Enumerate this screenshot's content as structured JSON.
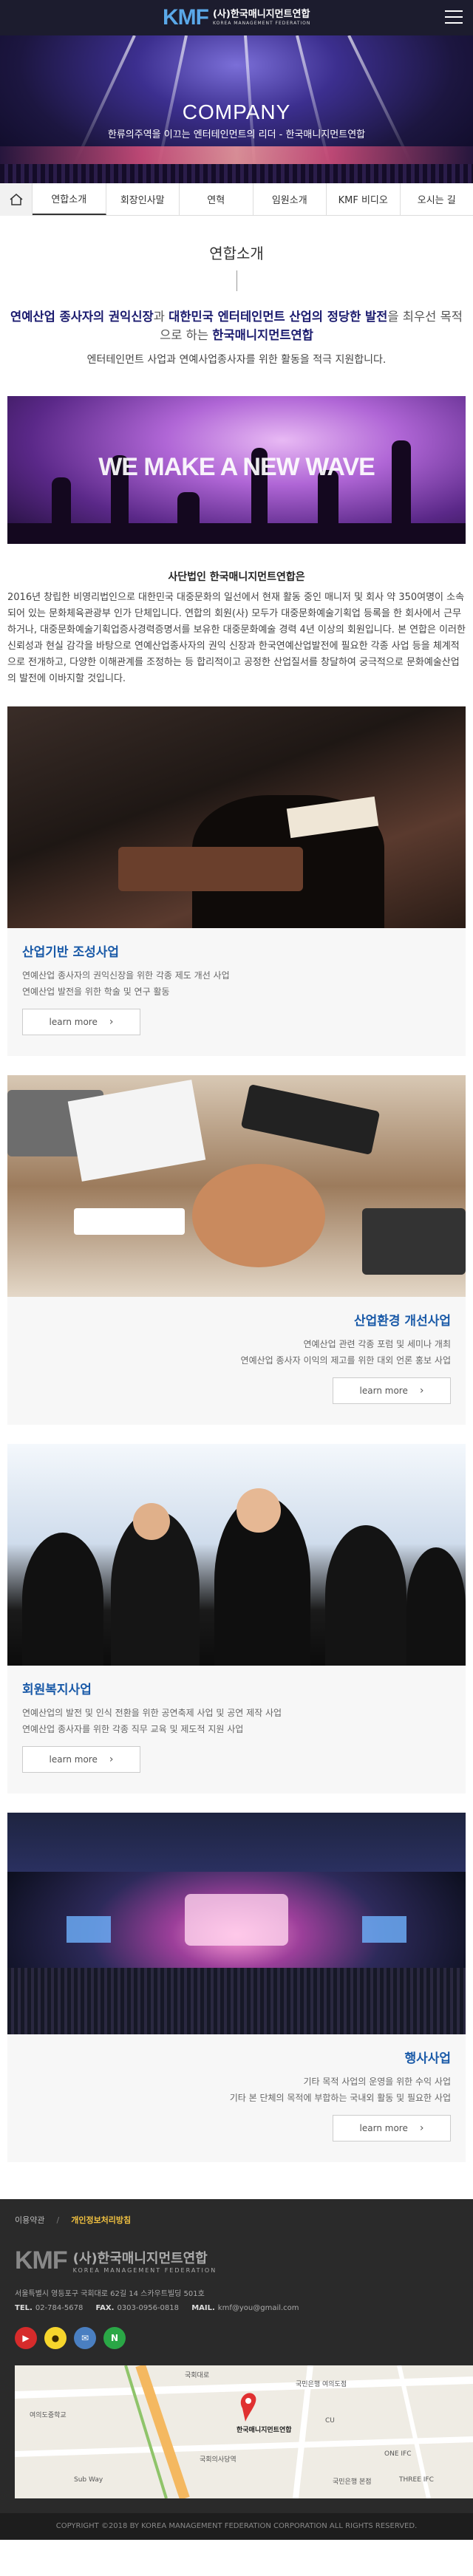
{
  "header": {
    "logo_mark": "KMF",
    "logo_name": "(사)한국매니지먼트연합",
    "logo_en": "KOREA MANAGEMENT FEDERATION"
  },
  "hero": {
    "title": "COMPANY",
    "subtitle": "한류의주역을 이끄는 엔터테인먼트의 리더 - 한국매니지먼트연합"
  },
  "tabs": [
    {
      "label": "연합소개",
      "active": true
    },
    {
      "label": "회장인사말",
      "active": false
    },
    {
      "label": "연혁",
      "active": false
    },
    {
      "label": "임원소개",
      "active": false
    },
    {
      "label": "KMF 비디오",
      "active": false
    },
    {
      "label": "오시는 길",
      "active": false
    }
  ],
  "intro": {
    "title": "연합소개",
    "lead_part1": "연예산업 종사자의 권익신장",
    "lead_plain1": "과 ",
    "lead_part2": "대한민국 엔터테인먼트 산업의 정당한 발전",
    "lead_plain2": "을 최우선 목적으로 하는 ",
    "lead_part3": "한국매니지먼트연합",
    "subline": "엔터테인먼트 사업과 연예사업종사자를 위한 활동을 적극 지원합니다.",
    "banner_text": "WE MAKE A NEW WAVE",
    "org_heading": "사단법인 한국매니지먼트연합은",
    "org_text": "2016년 창립한 비영리법인으로 대한민국 대중문화의 일선에서 현재 활동 중인 매니저 및 회사 약 350여명이 소속되어 있는 문화체육관광부 인가 단체입니다. 연합의 회원(사) 모두가 대중문화예술기획업 등록을 한 회사에서 근무하거나, 대중문화예술기획업증사경력증명서를 보유한 대중문화예술 경력 4년 이상의 회원입니다. 본 연합은 이러한 신뢰성과 현실 감각을 바탕으로 연예산업종사자의 권익 신장과 한국연예산업발전에 필요한 각종 사업 등을 체계적으로 전개하고, 다양한 이해관계를 조정하는 등 합리적이고 공정한 산업질서를 창달하여 궁극적으로 문화예술산업의 발전에 이바지할 것입니다."
  },
  "cards": [
    {
      "title": "산업기반 조성사업",
      "lines": [
        "연예산업 종사자의 권익신장을 위한 각종 제도 개선 사업",
        "연예산업 발전을 위한 학술 및 연구 활동"
      ],
      "button": "learn more",
      "align": "left"
    },
    {
      "title": "산업환경 개선사업",
      "lines": [
        "연예산업 관련 각종 포럼 및 세미나 개최",
        "연예산업 종사자 이익의 제고를 위한 대외 언론 홍보 사업"
      ],
      "button": "learn more",
      "align": "right"
    },
    {
      "title": "회원복지사업",
      "lines": [
        "연예산업의 발전 및 인식 전환을 위한 공연축제 사업 및 공연 제작 사업",
        "연예산업 종사자를 위한 각종 직무 교육 및 제도적 지원 사업"
      ],
      "button": "learn more",
      "align": "left"
    },
    {
      "title": "행사사업",
      "lines": [
        "기타 목적 사업의 운영을 위한 수익 사업",
        "기타 본 단체의 목적에 부합하는 국내외 활동 및 필요한 사업"
      ],
      "button": "learn more",
      "align": "right"
    }
  ],
  "footer": {
    "link1": "이용약관",
    "link2": "개인정보처리방침",
    "logo_mark": "KMF",
    "logo_name": "(사)한국매니지먼트연합",
    "logo_en": "KOREA MANAGEMENT FEDERATION",
    "address": "서울특별시 영등포구 국회대로 62길 14 스카우트빌딩 501호",
    "tel_label": "TEL.",
    "tel": "02-784-5678",
    "fax_label": "FAX.",
    "fax": "0303-0956-0818",
    "mail_label": "MAIL.",
    "mail": "kmf@you@gmail.com",
    "sns": [
      {
        "name": "youtube-icon",
        "glyph": "▶",
        "color": "#d62b2b"
      },
      {
        "name": "kakao-icon",
        "glyph": "●",
        "color": "#f6d52c"
      },
      {
        "name": "mail-icon",
        "glyph": "✉",
        "color": "#4a7fc1"
      },
      {
        "name": "naver-icon",
        "glyph": "N",
        "color": "#2aa746"
      }
    ],
    "map_labels": [
      "국회대로",
      "국민은행 여의도점",
      "한국매니지먼트연합",
      "국회의사당역",
      "CU",
      "여의도중학교",
      "Sub Way",
      "ONE IFC",
      "국민은행 본점",
      "THREE IFC"
    ],
    "copyright": "COPYRIGHT ©2018 BY KOREA MANAGEMENT FEDERATION CORPORATION ALL RIGHTS RESERVED."
  }
}
